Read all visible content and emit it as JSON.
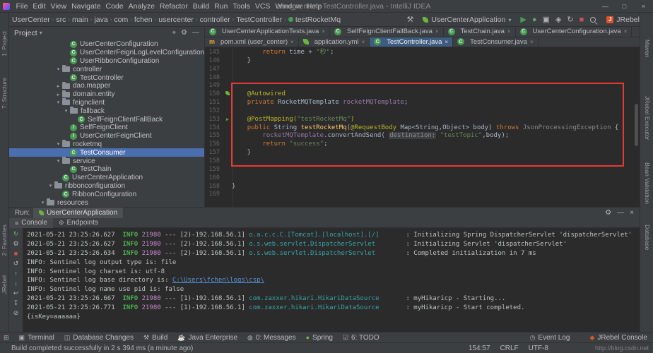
{
  "titlebar": {
    "title": "user_center - TestController.java - IntelliJ IDEA",
    "menus": [
      "File",
      "Edit",
      "View",
      "Navigate",
      "Code",
      "Analyze",
      "Refactor",
      "Build",
      "Run",
      "Tools",
      "VCS",
      "Window",
      "Help"
    ],
    "window_controls": [
      {
        "name": "minimize-button",
        "glyph": "—"
      },
      {
        "name": "maximize-button",
        "glyph": "□"
      },
      {
        "name": "close-button",
        "glyph": "×"
      }
    ]
  },
  "toolbar": {
    "breadcrumbs": [
      "UserCenter",
      "src",
      "main",
      "java",
      "com",
      "fchen",
      "usercenter",
      "controller",
      "TestController"
    ],
    "breadcrumb_method": "testRocketMq",
    "run_config": "UserCenterApplication",
    "jrebel_label": "JRebel",
    "action_icons": [
      {
        "name": "build-icon",
        "glyph": "⚒",
        "color": "#AFB1B3"
      }
    ],
    "run_icons": [
      {
        "name": "run-button",
        "glyph": "▶",
        "color": "#499C54"
      },
      {
        "name": "debug-button",
        "glyph": "●",
        "color": "#59A869"
      },
      {
        "name": "coverage-button",
        "glyph": "▣",
        "color": "#AFB1B3"
      },
      {
        "name": "profiler-button",
        "glyph": "◈",
        "color": "#AFB1B3"
      },
      {
        "name": "rerun-button",
        "glyph": "↻",
        "color": "#AFB1B3"
      },
      {
        "name": "stop-button",
        "glyph": "■",
        "color": "#C75450"
      }
    ]
  },
  "activity_bars": {
    "left_top": [
      "1: Project",
      "7: Structure"
    ],
    "left_bottom": [
      "2: Favorites",
      "JRebel"
    ],
    "right": [
      "Maven",
      "JRebel Executor",
      "Bean Validation",
      "Database"
    ]
  },
  "project_panel": {
    "header_label": "Project",
    "header_icons": [
      {
        "name": "locate-icon",
        "glyph": "⌖"
      },
      {
        "name": "settings-icon",
        "glyph": "⚙"
      },
      {
        "name": "hide-icon",
        "glyph": "—"
      }
    ],
    "tree": [
      {
        "level": 5,
        "icon": "class",
        "label": "UserCenterConfiguration"
      },
      {
        "level": 5,
        "icon": "class",
        "label": "UserCenterFeignLogLevelConfiguration"
      },
      {
        "level": 5,
        "icon": "class",
        "label": "UserRibbonConfiguration"
      },
      {
        "level": 4,
        "icon": "folder",
        "expand": "open",
        "label": "controller"
      },
      {
        "level": 5,
        "icon": "class",
        "label": "TestController"
      },
      {
        "level": 4,
        "icon": "folder",
        "expand": "closed",
        "label": "dao.mapper"
      },
      {
        "level": 4,
        "icon": "folder",
        "expand": "closed",
        "label": "domain.entity"
      },
      {
        "level": 4,
        "icon": "folder",
        "expand": "open",
        "label": "feignclient"
      },
      {
        "level": 5,
        "icon": "folder",
        "expand": "open",
        "label": "fallback"
      },
      {
        "level": 6,
        "icon": "class",
        "label": "SelfFeignClientFallBack"
      },
      {
        "level": 5,
        "icon": "interface",
        "label": "SelfFeignClient"
      },
      {
        "level": 5,
        "icon": "interface",
        "label": "UserCenterFeignClient"
      },
      {
        "level": 4,
        "icon": "folder",
        "expand": "open",
        "label": "rocketmq"
      },
      {
        "level": 5,
        "icon": "class",
        "label": "TestConsumer",
        "selected": true
      },
      {
        "level": 4,
        "icon": "folder",
        "expand": "open",
        "label": "service"
      },
      {
        "level": 5,
        "icon": "class",
        "label": "TestChain"
      },
      {
        "level": 4,
        "icon": "class",
        "label": "UserCenterApplication"
      },
      {
        "level": 3,
        "icon": "folder",
        "expand": "open",
        "label": "ribbonconfiguration"
      },
      {
        "level": 4,
        "icon": "class",
        "label": "RibbonConfiguration"
      },
      {
        "level": 2,
        "icon": "folder",
        "expand": "open",
        "label": "resources"
      }
    ]
  },
  "editor": {
    "tab_rows": [
      [
        {
          "icon": "class",
          "label": "UserCenterApplicationTests.java"
        },
        {
          "icon": "class",
          "label": "SelfFeignClientFallBack.java"
        },
        {
          "icon": "class",
          "label": "TestChain.java"
        },
        {
          "icon": "class",
          "label": "UserCenterConfiguration.java"
        }
      ],
      [
        {
          "icon": "maven",
          "label": "pom.xml (user_center)"
        },
        {
          "icon": "yml",
          "label": "application.yml"
        },
        {
          "icon": "class",
          "label": "TestController.java",
          "active": true
        },
        {
          "icon": "class",
          "label": "TestConsumer.java"
        }
      ]
    ],
    "code": [
      {
        "num": 145,
        "tokens": [
          [
            "pln",
            "        "
          ],
          [
            "kw",
            "return"
          ],
          [
            "pln",
            " time + "
          ],
          [
            "str",
            "\"秒\""
          ],
          [
            "pln",
            ";"
          ]
        ]
      },
      {
        "num": 146,
        "tokens": [
          [
            "pln",
            "    }"
          ]
        ]
      },
      {
        "num": 147,
        "tokens": []
      },
      {
        "num": 148,
        "tokens": []
      },
      {
        "num": 149,
        "tokens": []
      },
      {
        "num": 150,
        "gutter": "bean",
        "tokens": [
          [
            "pln",
            "    "
          ],
          [
            "ann",
            "@Autowired"
          ]
        ]
      },
      {
        "num": 151,
        "tokens": [
          [
            "pln",
            "    "
          ],
          [
            "kw",
            "private "
          ],
          [
            "pln",
            "RocketMQTemplate "
          ],
          [
            "fld",
            "rocketMQTemplate"
          ],
          [
            "pln",
            ";"
          ]
        ]
      },
      {
        "num": 152,
        "tokens": []
      },
      {
        "num": 153,
        "gutter": "run",
        "tokens": [
          [
            "pln",
            "    "
          ],
          [
            "ann",
            "@PostMapping("
          ],
          [
            "str",
            "\"testRocketMq\""
          ],
          [
            "ann",
            ")"
          ]
        ]
      },
      {
        "num": 154,
        "tokens": [
          [
            "pln",
            "    "
          ],
          [
            "kw",
            "public "
          ],
          [
            "pln",
            "String "
          ],
          [
            "mth",
            "testRocketMq"
          ],
          [
            "pln",
            "("
          ],
          [
            "ann",
            "@RequestBody"
          ],
          [
            "pln",
            " Map<String,Object> body) "
          ],
          [
            "kw",
            "throws"
          ],
          [
            "pln",
            " "
          ],
          [
            "dim",
            "JsonProcessingException"
          ],
          [
            "pln",
            " {"
          ]
        ]
      },
      {
        "num": 155,
        "tokens": [
          [
            "pln",
            "        "
          ],
          [
            "fld",
            "rocketMQTemplate"
          ],
          [
            "pln",
            ".convertAndSend( "
          ],
          [
            "hint",
            "destination:"
          ],
          [
            "pln",
            " "
          ],
          [
            "str",
            "\"testTopic\""
          ],
          [
            "pln",
            ",body);"
          ]
        ]
      },
      {
        "num": 156,
        "tokens": [
          [
            "pln",
            "        "
          ],
          [
            "kw",
            "return "
          ],
          [
            "str",
            "\"success\""
          ],
          [
            "pln",
            ";"
          ]
        ]
      },
      {
        "num": 157,
        "tokens": [
          [
            "pln",
            "    }"
          ]
        ]
      },
      {
        "num": 158,
        "tokens": []
      },
      {
        "num": 159,
        "tokens": []
      },
      {
        "num": 160,
        "tokens": []
      },
      {
        "num": 168,
        "tokens": [
          [
            "pln",
            "}"
          ]
        ]
      },
      {
        "num": 169,
        "tokens": []
      }
    ]
  },
  "run_panel": {
    "run_label": "Run:",
    "tab_label": "UserCenterApplication",
    "header_icons": [
      {
        "name": "settings-icon",
        "glyph": "⚙"
      },
      {
        "name": "minimize-icon",
        "glyph": "—"
      },
      {
        "name": "close-icon",
        "glyph": "×"
      }
    ],
    "view_tabs": [
      {
        "label": "Console",
        "icon": "≡",
        "active": true
      },
      {
        "label": "Endpoints",
        "icon": "⊚"
      }
    ],
    "strip_icons": [
      {
        "name": "rerun-icon",
        "glyph": "↻",
        "color": "#6CAD62"
      },
      {
        "name": "settings-icon",
        "glyph": "⚙",
        "color": "#AFB1B3"
      },
      {
        "name": "stop-icon",
        "glyph": "■",
        "color": "#C75450"
      },
      {
        "name": "restart-icon",
        "glyph": "↺",
        "color": "#AFB1B3"
      },
      {
        "name": "up-stack-icon",
        "glyph": "↑",
        "color": "#AFB1B3"
      },
      {
        "name": "down-stack-icon",
        "glyph": "↓",
        "color": "#AFB1B3"
      },
      {
        "name": "soft-wrap-icon",
        "glyph": "↩",
        "color": "#AFB1B3"
      },
      {
        "name": "scroll-end-icon",
        "glyph": "↧",
        "color": "#AFB1B3"
      },
      {
        "name": "clear-icon",
        "glyph": "⊘",
        "color": "#AFB1B3"
      }
    ],
    "console": [
      [
        [
          "pln",
          "2021-05-21 23:25:26.627  "
        ],
        [
          "info",
          "INFO"
        ],
        [
          "pln",
          " "
        ],
        [
          "pid",
          "21980"
        ],
        [
          "pln",
          " --- [2)-192.168.56.1] "
        ],
        [
          "log",
          "o.a.c.c.C.[Tomcat].[localhost].[/]"
        ],
        [
          "pln",
          "       : Initializing Spring DispatcherServlet 'dispatcherServlet'"
        ]
      ],
      [
        [
          "pln",
          "2021-05-21 23:25:26.627  "
        ],
        [
          "info",
          "INFO"
        ],
        [
          "pln",
          " "
        ],
        [
          "pid",
          "21980"
        ],
        [
          "pln",
          " --- [2)-192.168.56.1] "
        ],
        [
          "log",
          "o.s.web.servlet.DispatcherServlet"
        ],
        [
          "pln",
          "        : Initializing Servlet 'dispatcherServlet'"
        ]
      ],
      [
        [
          "pln",
          "2021-05-21 23:25:26.634  "
        ],
        [
          "info",
          "INFO"
        ],
        [
          "pln",
          " "
        ],
        [
          "pid",
          "21980"
        ],
        [
          "pln",
          " --- [2)-192.168.56.1] "
        ],
        [
          "log",
          "o.s.web.servlet.DispatcherServlet"
        ],
        [
          "pln",
          "        : Completed initialization in 7 ms"
        ]
      ],
      [
        [
          "pln",
          "INFO: Sentinel log output type is: file"
        ]
      ],
      [
        [
          "pln",
          "INFO: Sentinel log charset is: utf-8"
        ]
      ],
      [
        [
          "pln",
          "INFO: Sentinel log base directory is: "
        ],
        [
          "link",
          "C:\\Users\\fchen\\logs\\csp\\"
        ]
      ],
      [
        [
          "pln",
          "INFO: Sentinel log name use pid is: false"
        ]
      ],
      [
        [
          "pln",
          "2021-05-21 23:25:26.667  "
        ],
        [
          "info",
          "INFO"
        ],
        [
          "pln",
          " "
        ],
        [
          "pid",
          "21980"
        ],
        [
          "pln",
          " --- [1)-192.168.56.1] "
        ],
        [
          "log",
          "com.zaxxer.hikari.HikariDataSource"
        ],
        [
          "pln",
          "       : myHikaricp - Starting..."
        ]
      ],
      [
        [
          "pln",
          "2021-05-21 23:25:26.771  "
        ],
        [
          "info",
          "INFO"
        ],
        [
          "pln",
          " "
        ],
        [
          "pid",
          "21980"
        ],
        [
          "pln",
          " --- [1)-192.168.56.1] "
        ],
        [
          "log",
          "com.zaxxer.hikari.HikariDataSource"
        ],
        [
          "pln",
          "       : myHikaricp - Start completed."
        ]
      ],
      [
        [
          "pln",
          "{isKey=aaaaaa}"
        ]
      ]
    ]
  },
  "bottom_bar": {
    "left": [
      {
        "name": "to​olwindow-switcher",
        "glyph": "⊞",
        "label": ""
      },
      {
        "name": "terminal",
        "glyph": "▣",
        "label": "Terminal"
      },
      {
        "name": "database-changes",
        "glyph": "◫",
        "label": "Database Changes"
      },
      {
        "name": "build",
        "glyph": "⚒",
        "label": "Build"
      },
      {
        "name": "java-enterprise",
        "glyph": "☕",
        "label": "Java Enterprise"
      },
      {
        "name": "messages",
        "glyph": "◍",
        "label": "0: Messages"
      },
      {
        "name": "spring",
        "glyph": "●",
        "color": "#6DB33F",
        "label": "Spring"
      },
      {
        "name": "todo",
        "glyph": "☑",
        "label": "6: TODO"
      }
    ],
    "right": [
      {
        "name": "event-log",
        "glyph": "◷",
        "label": "Event Log"
      },
      {
        "name": "jrebel-console",
        "glyph": "◆",
        "color": "#E0542C",
        "label": "JRebel Console"
      }
    ]
  },
  "status_bar": {
    "message": "Build completed successfully in 2 s 394 ms (a minute ago)",
    "position": "154:57",
    "line_ending": "CRLF",
    "encoding": "UTF-8",
    "watermark": "http://blog.csdn.net"
  },
  "annotation": {
    "note": "red highlight box around RocketMQ code",
    "color": "#E53935"
  }
}
